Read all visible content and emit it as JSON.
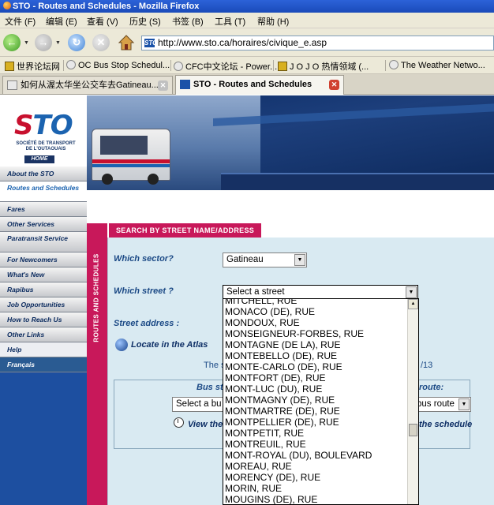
{
  "window": {
    "title": "STO - Routes and Schedules - Mozilla Firefox"
  },
  "menu": [
    "文件 (F)",
    "编辑 (E)",
    "查看 (V)",
    "历史 (S)",
    "书签 (B)",
    "工具 (T)",
    "帮助 (H)"
  ],
  "url": "http://www.sto.ca/horaires/civique_e.asp",
  "bookmarks": [
    "世界论坛网",
    "OC Bus Stop Schedul...",
    "CFC中文论坛 - Power...",
    "J O J O 热情领域 (...",
    "The Weather Netwo..."
  ],
  "tabs": [
    {
      "label": "如何从渥太华坐公交车去Gatineau..."
    },
    {
      "label": "STO - Routes and Schedules"
    }
  ],
  "logo": {
    "mark_a": "S",
    "mark_b": "TO",
    "subtitle": "SOCIÉTÉ DE TRANSPORT DE L'OUTAOUAIS"
  },
  "home_label": "HOME",
  "nav": [
    "About the STO",
    "Routes and Schedules",
    "Fares",
    "Other Services",
    "Paratransit Service",
    "For Newcomers",
    "What's New",
    "Rapibus",
    "Job Opportunities",
    "How to Reach Us",
    "Other Links",
    "Help",
    "Français"
  ],
  "section": {
    "vertical_title": "ROUTES AND SCHEDULES",
    "header": "SEARCH BY STREET NAME/ADDRESS"
  },
  "form": {
    "sector_label": "Which sector?",
    "sector_value": "Gatineau",
    "street_label": "Which street ?",
    "street_value": "Select a street",
    "address_label": "Street address :",
    "atlas_link": "Locate in the Atlas",
    "info_head": "The s",
    "info_tail": "/13",
    "bus_stop_label": "Bus st",
    "route_label": "route:",
    "bus_stop_select": "Select a bu",
    "route_select": "bus route",
    "view_label": "View the",
    "schedule_label": "the schedule"
  },
  "streets": [
    "MITCHELL, RUE",
    "MONACO (DE), RUE",
    "MONDOUX, RUE",
    "MONSEIGNEUR-FORBES, RUE",
    "MONTAGNE (DE LA), RUE",
    "MONTEBELLO (DE), RUE",
    "MONTE-CARLO (DE), RUE",
    "MONTFORT (DE), RUE",
    "MONT-LUC (DU), RUE",
    "MONTMAGNY (DE), RUE",
    "MONTMARTRE (DE), RUE",
    "MONTPELLIER (DE), RUE",
    "MONTPETIT, RUE",
    "MONTREUIL, RUE",
    "MONT-ROYAL (DU), BOULEVARD",
    "MOREAU, RUE",
    "MORENCY (DE), RUE",
    "MORIN, RUE",
    "MOUGINS (DE), RUE"
  ],
  "colors": {
    "accent": "#c8185a",
    "brand_blue": "#1b63b0",
    "panel": "#d9eaf2"
  }
}
